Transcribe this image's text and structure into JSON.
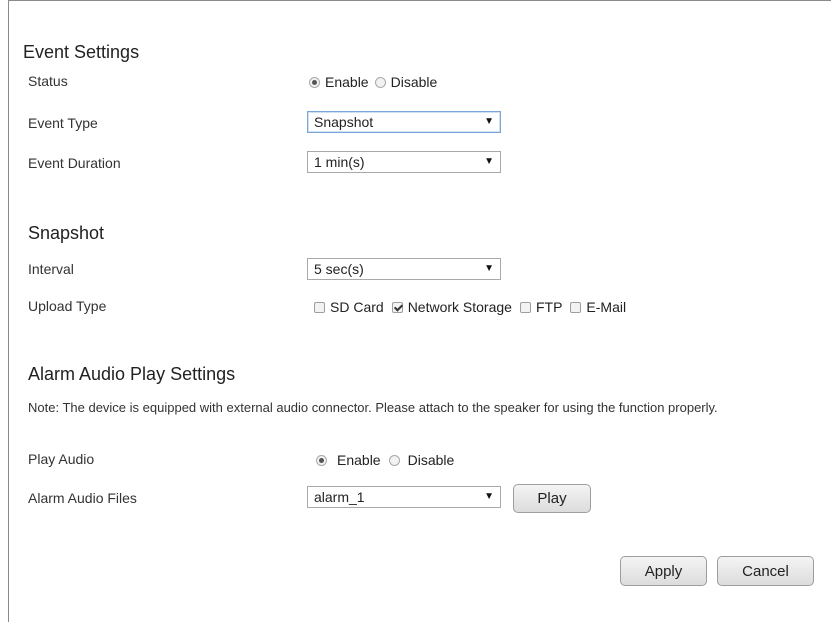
{
  "event_settings": {
    "title": "Event Settings",
    "status": {
      "label": "Status",
      "options": [
        "Enable",
        "Disable"
      ],
      "selected": "Enable"
    },
    "event_type": {
      "label": "Event Type",
      "value": "Snapshot"
    },
    "event_duration": {
      "label": "Event Duration",
      "value": "1 min(s)"
    }
  },
  "snapshot": {
    "title": "Snapshot",
    "interval": {
      "label": "Interval",
      "value": "5 sec(s)"
    },
    "upload_type": {
      "label": "Upload Type",
      "options": [
        {
          "label": "SD Card",
          "checked": false
        },
        {
          "label": "Network Storage",
          "checked": true
        },
        {
          "label": "FTP",
          "checked": false
        },
        {
          "label": "E-Mail",
          "checked": false
        }
      ]
    }
  },
  "alarm_audio": {
    "title": "Alarm Audio Play Settings",
    "note": "Note: The device is equipped with external audio connector. Please attach to the speaker for using the function properly.",
    "play_audio": {
      "label": "Play Audio",
      "options": [
        "Enable",
        "Disable"
      ],
      "selected": "Enable"
    },
    "audio_files": {
      "label": "Alarm Audio Files",
      "value": "alarm_1"
    },
    "play_button": "Play"
  },
  "actions": {
    "apply": "Apply",
    "cancel": "Cancel"
  },
  "icons": {
    "dropdown": "dropdown-caret-icon"
  }
}
